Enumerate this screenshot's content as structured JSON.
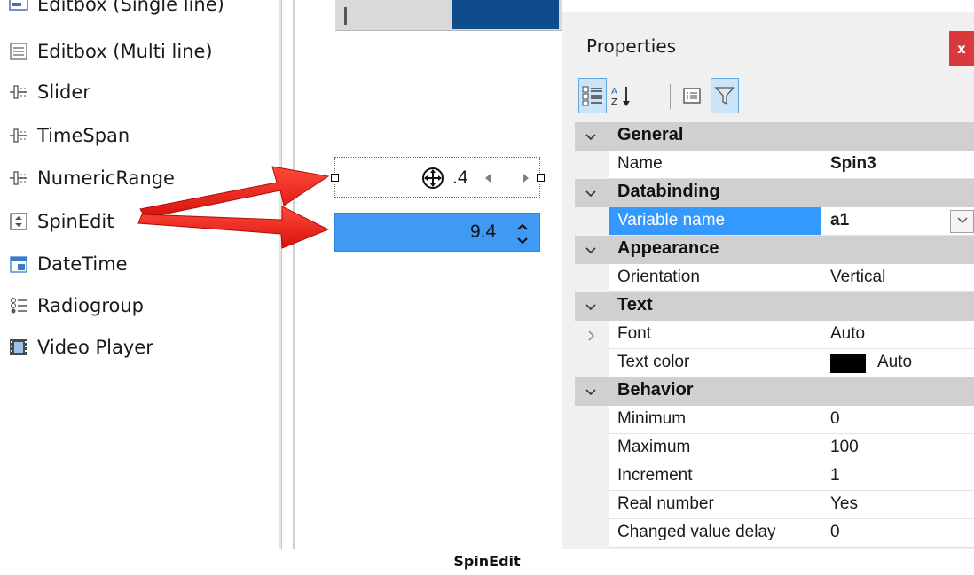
{
  "toolbox": {
    "items": [
      {
        "label": "Editbox (Single line)",
        "icon": "editbox-single-icon"
      },
      {
        "label": "Editbox (Multi line)",
        "icon": "editbox-multi-icon"
      },
      {
        "label": "Slider",
        "icon": "slider-icon"
      },
      {
        "label": "TimeSpan",
        "icon": "timespan-icon"
      },
      {
        "label": "NumericRange",
        "icon": "numericrange-icon"
      },
      {
        "label": "SpinEdit",
        "icon": "spinedit-icon"
      },
      {
        "label": "DateTime",
        "icon": "datetime-icon"
      },
      {
        "label": "Radiogroup",
        "icon": "radiogroup-icon"
      },
      {
        "label": "Video Player",
        "icon": "video-player-icon"
      }
    ]
  },
  "canvas": {
    "selected_spin_value": ".4",
    "blue_spin_value": "9.4"
  },
  "properties": {
    "title": "Properties",
    "close_label": "x",
    "categories": [
      {
        "name": "General",
        "rows": [
          {
            "name": "Name",
            "value": "Spin3",
            "bold": true
          }
        ]
      },
      {
        "name": "Databinding",
        "rows": [
          {
            "name": "Variable name",
            "value": "a1",
            "bold": true,
            "selected": true,
            "dropdown": true
          }
        ]
      },
      {
        "name": "Appearance",
        "rows": [
          {
            "name": "Orientation",
            "value": "Vertical"
          }
        ]
      },
      {
        "name": "Text",
        "rows": [
          {
            "name": "Font",
            "value": "Auto",
            "expandable": true
          },
          {
            "name": "Text color",
            "value": "Auto",
            "swatch": "#000000"
          }
        ]
      },
      {
        "name": "Behavior",
        "rows": [
          {
            "name": "Minimum",
            "value": "0"
          },
          {
            "name": "Maximum",
            "value": "100"
          },
          {
            "name": "Increment",
            "value": "1"
          },
          {
            "name": "Real number",
            "value": "Yes"
          },
          {
            "name": "Changed value delay",
            "value": "0"
          }
        ]
      }
    ]
  },
  "caption": "SpinEdit",
  "colors": {
    "accent_blue": "#3399ff",
    "spin_blue": "#3f9af5",
    "close_red": "#d9393b",
    "arrow_red": "#e8201f",
    "category_gray": "#d0d0d0"
  }
}
